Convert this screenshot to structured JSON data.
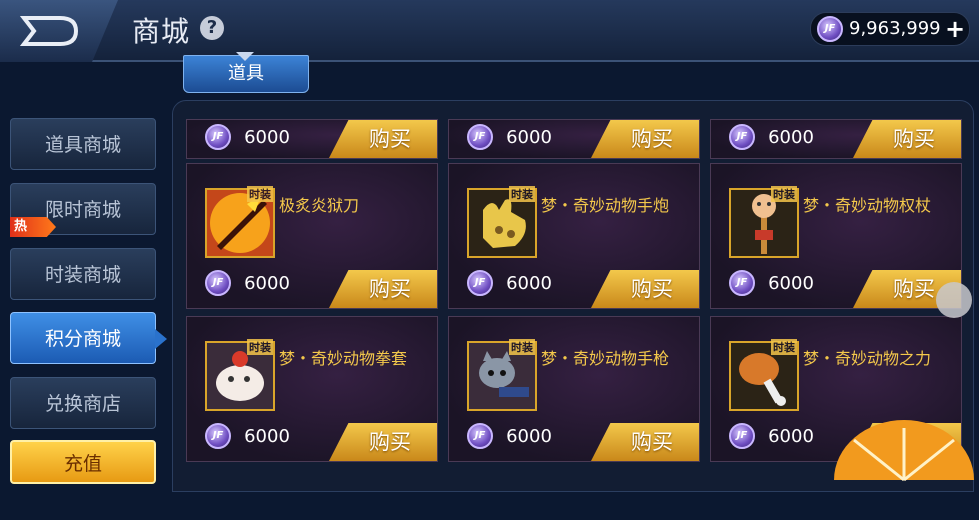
{
  "header": {
    "title": "商城",
    "help": "?",
    "currency_value": "9,963,999",
    "plus": "+"
  },
  "category_tab": "道具",
  "sidebar": {
    "items": [
      {
        "label": "道具商城"
      },
      {
        "label": "限时商城"
      },
      {
        "label": "时装商城"
      },
      {
        "label": "积分商城"
      },
      {
        "label": "兑换商店"
      }
    ],
    "active_index": 3,
    "hot_badge": "热",
    "recharge": "充值"
  },
  "coin_glyph": "JF",
  "buy_label": "购买",
  "top_row_prices": [
    "6000",
    "6000",
    "6000"
  ],
  "products": [
    {
      "name": "极炙炎狱刀",
      "tag": "时装",
      "price": "6000",
      "icon": "flame-sword-icon"
    },
    {
      "name": "梦・奇妙动物手炮",
      "tag": "时装",
      "price": "6000",
      "icon": "glove-cannon-icon"
    },
    {
      "name": "梦・奇妙动物权杖",
      "tag": "时装",
      "price": "6000",
      "icon": "scepter-icon"
    },
    {
      "name": "梦・奇妙动物拳套",
      "tag": "时装",
      "price": "6000",
      "icon": "sheep-gauntlet-icon"
    },
    {
      "name": "梦・奇妙动物手枪",
      "tag": "时装",
      "price": "6000",
      "icon": "cat-pistol-icon"
    },
    {
      "name": "梦・奇妙动物之力",
      "tag": "时装",
      "price": "6000",
      "icon": "drumstick-icon"
    }
  ],
  "colors": {
    "accent_gold": "#f3c84b",
    "active_blue": "#2a72cc",
    "card_bg": "#1b1426"
  }
}
